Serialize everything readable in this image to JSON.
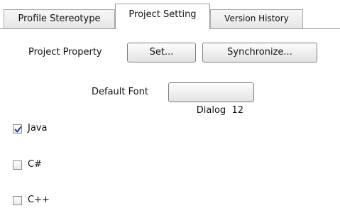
{
  "tabs": [
    {
      "label": "Profile Stereotype",
      "selected": false
    },
    {
      "label": "Project Setting",
      "selected": true
    },
    {
      "label": "Version History",
      "selected": false
    }
  ],
  "project_property": {
    "label": "Project Property",
    "set_button": "Set...",
    "synchronize_button": "Synchronize..."
  },
  "default_font": {
    "label": "Default Font",
    "value_button": "Dialog  12"
  },
  "languages": [
    {
      "label": "Java",
      "checked": true
    },
    {
      "label": "C#",
      "checked": false
    },
    {
      "label": "C++",
      "checked": false
    }
  ],
  "colors": {
    "check_mark": "#1a3c8c",
    "tab_border": "#a9a9a9",
    "button_border": "#7f7f7f"
  }
}
